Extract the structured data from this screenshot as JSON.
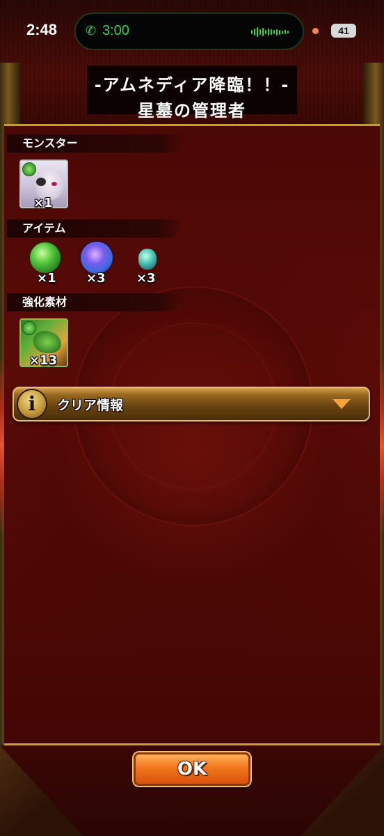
{
  "status_bar": {
    "time": "2:48",
    "call_time": "3:00",
    "battery": "41"
  },
  "title": {
    "line1": "-アムネディア降臨！！-",
    "line2": "星墓の管理者"
  },
  "sections": {
    "monster": {
      "label": "モンスター",
      "items": [
        {
          "icon": "monster-portrait-icon",
          "count": "×1"
        }
      ]
    },
    "items": {
      "label": "アイテム",
      "items": [
        {
          "icon": "green-gem-icon",
          "count": "×1"
        },
        {
          "icon": "blue-gem-icon",
          "count": "×3"
        },
        {
          "icon": "small-teal-gem-icon",
          "count": "×3"
        }
      ]
    },
    "materials": {
      "label": "強化素材",
      "items": [
        {
          "icon": "dragon-portrait-icon",
          "count": "×13"
        }
      ]
    }
  },
  "clear_info": {
    "label": "クリア情報"
  },
  "ok_button": {
    "label": "OK"
  },
  "colors": {
    "panel_border": "#c79a3c",
    "info_bar": "#9a6a20",
    "ok_button": "#f2761e",
    "call_green": "#37d24a"
  }
}
